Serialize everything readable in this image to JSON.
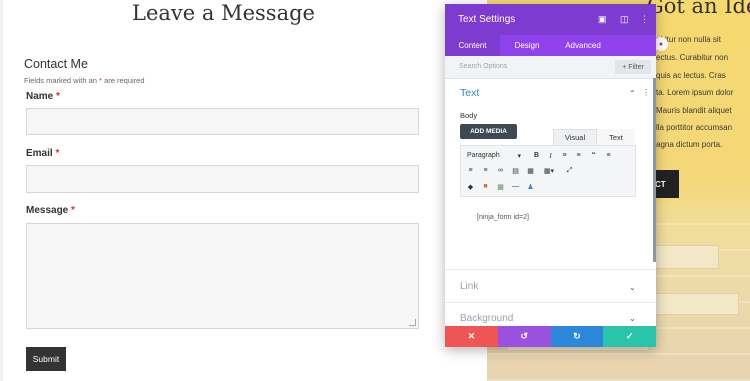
{
  "page": {
    "title": "Leave a Message",
    "contact_title": "Contact Me",
    "required_note_prefix": "Fields marked with an",
    "required_note_star": "*",
    "required_note_suffix": "are required"
  },
  "form": {
    "fields": [
      {
        "label": "Name",
        "required": "*"
      },
      {
        "label": "Email",
        "required": "*"
      },
      {
        "label": "Message",
        "required": "*"
      }
    ],
    "submit_label": "Submit"
  },
  "background": {
    "heading": "Got an Idea?",
    "lines": [
      "abitur non nulla sit",
      "ectus. Curabitur non",
      "quis ac lectus. Cras",
      "ta. Lorem ipsum dolor",
      "Mauris blandit aliquet",
      "lla porttitor accumsan",
      "agna dictum porta."
    ],
    "button_label": "CT"
  },
  "modal": {
    "title": "Text Settings",
    "tabs": [
      "Content",
      "Design",
      "Advanced"
    ],
    "search_placeholder": "Search Options",
    "filter_label": "+ Filter",
    "section_title": "Text",
    "body_label": "Body",
    "add_media_label": "ADD MEDIA",
    "editor_tabs": {
      "visual": "Visual",
      "text": "Text"
    },
    "paragraph_select": "Paragraph",
    "editor_content": "[ninja_form id=2]",
    "collapsed_sections": [
      "Link",
      "Background"
    ]
  },
  "colors": {
    "header_purple": "#7e3bd0",
    "tabs_purple": "#8f42ec",
    "section_blue": "#2b87da",
    "cancel_red": "#ef5555",
    "undo_purple": "#9b51e0",
    "redo_blue": "#2b87da",
    "save_green": "#29c4a9"
  },
  "icons": {
    "close": "close-icon",
    "undo": "undo-icon",
    "redo": "redo-icon",
    "save": "check-icon"
  }
}
